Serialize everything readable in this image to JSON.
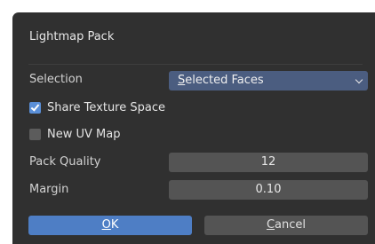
{
  "dialog": {
    "title": "Lightmap Pack",
    "selection": {
      "label": "Selection",
      "value_first": "S",
      "value_rest": "elected Faces"
    },
    "share_texture_space": {
      "label": "Share Texture Space",
      "checked": true
    },
    "new_uv_map": {
      "label": "New UV Map",
      "checked": false
    },
    "pack_quality": {
      "label": "Pack Quality",
      "value": "12"
    },
    "margin": {
      "label": "Margin",
      "value": "0.10"
    },
    "ok_first": "O",
    "ok_rest": "K",
    "cancel_first": "C",
    "cancel_rest": "ancel"
  },
  "colors": {
    "dialog_bg": "#303030",
    "dropdown_bg": "#4b5d80",
    "ok_bg": "#4e7ec5",
    "field_bg": "#545454",
    "checkbox_on": "#5a8fd8"
  }
}
